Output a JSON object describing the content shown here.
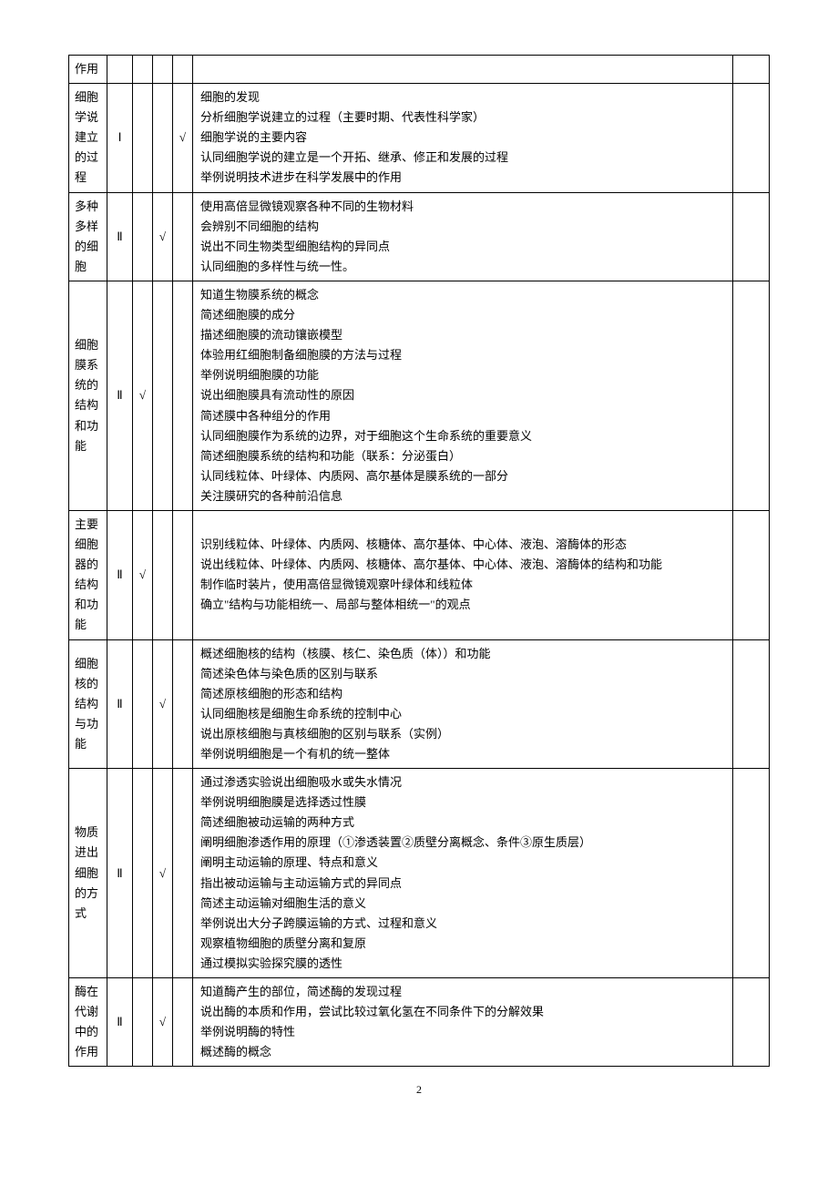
{
  "page_number": "2",
  "check_mark": "√",
  "rows": [
    {
      "topic": "作用",
      "level": "",
      "checks": [
        "",
        "",
        ""
      ],
      "content_lines": [
        ""
      ],
      "wrap": false
    },
    {
      "topic": "细胞学说建立的过程",
      "level": "Ⅰ",
      "checks": [
        "",
        "",
        "√"
      ],
      "content_lines": [
        "细胞的发现",
        "分析细胞学说建立的过程（主要时期、代表性科学家）",
        "细胞学说的主要内容",
        "认同细胞学说的建立是一个开拓、继承、修正和发展的过程",
        "举例说明技术进步在科学发展中的作用"
      ],
      "wrap": false
    },
    {
      "topic": "多种多样的细胞",
      "level": "Ⅱ",
      "checks": [
        "",
        "√",
        ""
      ],
      "content_lines": [
        "使用高倍显微镜观察各种不同的生物材料",
        "会辨别不同细胞的结构",
        "说出不同生物类型细胞结构的异同点",
        "认同细胞的多样性与统一性。"
      ],
      "wrap": false
    },
    {
      "topic": "细胞膜系统的结构和功能",
      "level": "Ⅱ",
      "checks": [
        "√",
        "",
        ""
      ],
      "content_lines": [
        "知道生物膜系统的概念",
        "简述细胞膜的成分",
        "描述细胞膜的流动镶嵌模型",
        "体验用红细胞制备细胞膜的方法与过程",
        "举例说明细胞膜的功能",
        "说出细胞膜具有流动性的原因",
        "简述膜中各种组分的作用",
        "认同细胞膜作为系统的边界，对于细胞这个生命系统的重要意义",
        "简述细胞膜系统的结构和功能（联系：分泌蛋白）",
        "认同线粒体、叶绿体、内质网、高尔基体是膜系统的一部分",
        "关注膜研究的各种前沿信息"
      ],
      "wrap": false
    },
    {
      "topic": "主要细胞器的结构和功能",
      "level": "Ⅱ",
      "checks": [
        "√",
        "",
        ""
      ],
      "content_lines": [
        "识别线粒体、叶绿体、内质网、核糖体、高尔基体、中心体、液泡、溶酶体的形态",
        "说出线粒体、叶绿体、内质网、核糖体、高尔基体、中心体、液泡、溶酶体的结构和功能",
        "制作临时装片，使用高倍显微镜观察叶绿体和线粒体",
        "确立\"结构与功能相统一、局部与整体相统一\"的观点"
      ],
      "wrap": true
    },
    {
      "topic": "细胞核的结构与功能",
      "level": "Ⅱ",
      "checks": [
        "",
        "√",
        ""
      ],
      "content_lines": [
        "概述细胞核的结构（核膜、核仁、染色质（体））和功能",
        "简述染色体与染色质的区别与联系",
        "简述原核细胞的形态和结构",
        "认同细胞核是细胞生命系统的控制中心",
        "说出原核细胞与真核细胞的区别与联系（实例）",
        "举例说明细胞是一个有机的统一整体"
      ],
      "wrap": false
    },
    {
      "topic": "物质进出细胞的方式",
      "level": "Ⅱ",
      "checks": [
        "",
        "√",
        ""
      ],
      "content_lines": [
        "通过渗透实验说出细胞吸水或失水情况",
        "举例说明细胞膜是选择透过性膜",
        "简述细胞被动运输的两种方式",
        "阐明细胞渗透作用的原理（①渗透装置②质壁分离概念、条件③原生质层）",
        "阐明主动运输的原理、特点和意义",
        "指出被动运输与主动运输方式的异同点",
        "简述主动运输对细胞生活的意义",
        "举例说出大分子跨膜运输的方式、过程和意义",
        "观察植物细胞的质壁分离和复原",
        "通过模拟实验探究膜的透性"
      ],
      "wrap": false
    },
    {
      "topic": "酶在代谢中的作用",
      "level": "Ⅱ",
      "checks": [
        "",
        "√",
        ""
      ],
      "content_lines": [
        "知道酶产生的部位，简述酶的发现过程",
        "说出酶的本质和作用，尝试比较过氧化氢在不同条件下的分解效果",
        "举例说明酶的特性",
        "概述酶的概念"
      ],
      "wrap": false
    }
  ]
}
